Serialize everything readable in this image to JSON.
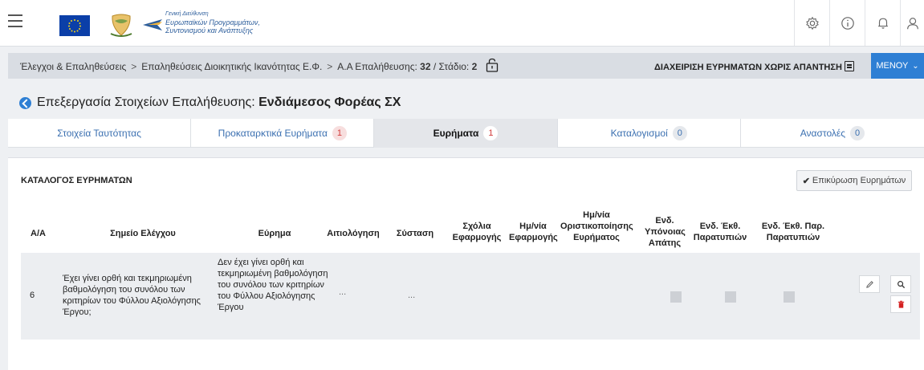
{
  "header": {
    "logo_text_line1": "Γενική Διεύθυνση",
    "logo_text_line2": "Ευρωπαϊκών Προγραμμάτων,",
    "logo_text_line3": "Συντονισμού και Ανάπτυξης"
  },
  "breadcrumb": {
    "item1": "Έλεγχοι & Επαληθεύσεις",
    "item2": "Επαληθεύσεις Διοικητικής Ικανότητας Ε.Φ.",
    "item3_prefix": "Α.Α Επαλήθευσης:",
    "item3_value": "32",
    "item3_stage_prefix": "/ Στάδιο:",
    "item3_stage_value": "2"
  },
  "unanswered_label": "ΔΙΑΧΕΙΡΙΣΗ ΕΥΡΗΜΑΤΩΝ ΧΩΡΙΣ ΑΠΑΝΤΗΣΗ",
  "menu_label": "ΜΕΝΟΥ",
  "page_title_prefix": "Επεξεργασία Στοιχείων Επαλήθευσης:",
  "page_title_entity": "Ενδιάμεσος Φορέας ΣΧ",
  "tabs": [
    {
      "label": "Στοιχεία Ταυτότητας",
      "badge": ""
    },
    {
      "label": "Προκαταρκτικά Ευρήματα",
      "badge": "1"
    },
    {
      "label": "Ευρήματα",
      "badge": "1"
    },
    {
      "label": "Καταλογισμοί",
      "badge": "0"
    },
    {
      "label": "Αναστολές",
      "badge": "0"
    }
  ],
  "panel": {
    "title": "ΚΑΤΑΛΟΓΟΣ ΕΥΡΗΜΑΤΩΝ",
    "confirm_label": "Επικύρωση Ευρημάτων"
  },
  "table": {
    "headers": {
      "aa": "Α/Α",
      "control_point": "Σημείο Ελέγχου",
      "finding": "Εύρημα",
      "justification": "Αιτιολόγηση",
      "recommendation": "Σύσταση",
      "impl_comments": "Σχόλια Εφαρμογής",
      "impl_date": "Ημ/νία Εφαρμογής",
      "final_date": "Ημ/νία Οριστικοποίησης Ευρήματος",
      "fraud": "Ενδ. Υπόνοιας Απάτης",
      "irreg_report": "Ενδ. Έκθ. Παρατυπιών",
      "irreg_report_par": "Ενδ. Έκθ. Παρ. Παρατυπιών"
    },
    "rows": [
      {
        "aa": "6",
        "control_point": "Έχει γίνει ορθή και τεκμηριωμένη βαθμολόγηση του συνόλου των κριτηρίων του Φύλλου Αξιολόγησης Έργου;",
        "finding": "Δεν έχει γίνει ορθή και τεκμηριωμένη βαθμολόγηση του συνόλου των κριτηρίων του Φύλλου Αξιολόγησης Έργου",
        "justification": "...",
        "recommendation": "...",
        "fraud": false,
        "irreg_report": false,
        "irreg_report_par": false
      }
    ]
  },
  "colors": {
    "accent": "#2e7fd4",
    "badge_red": "#d23a3a",
    "delete": "#d42020"
  }
}
